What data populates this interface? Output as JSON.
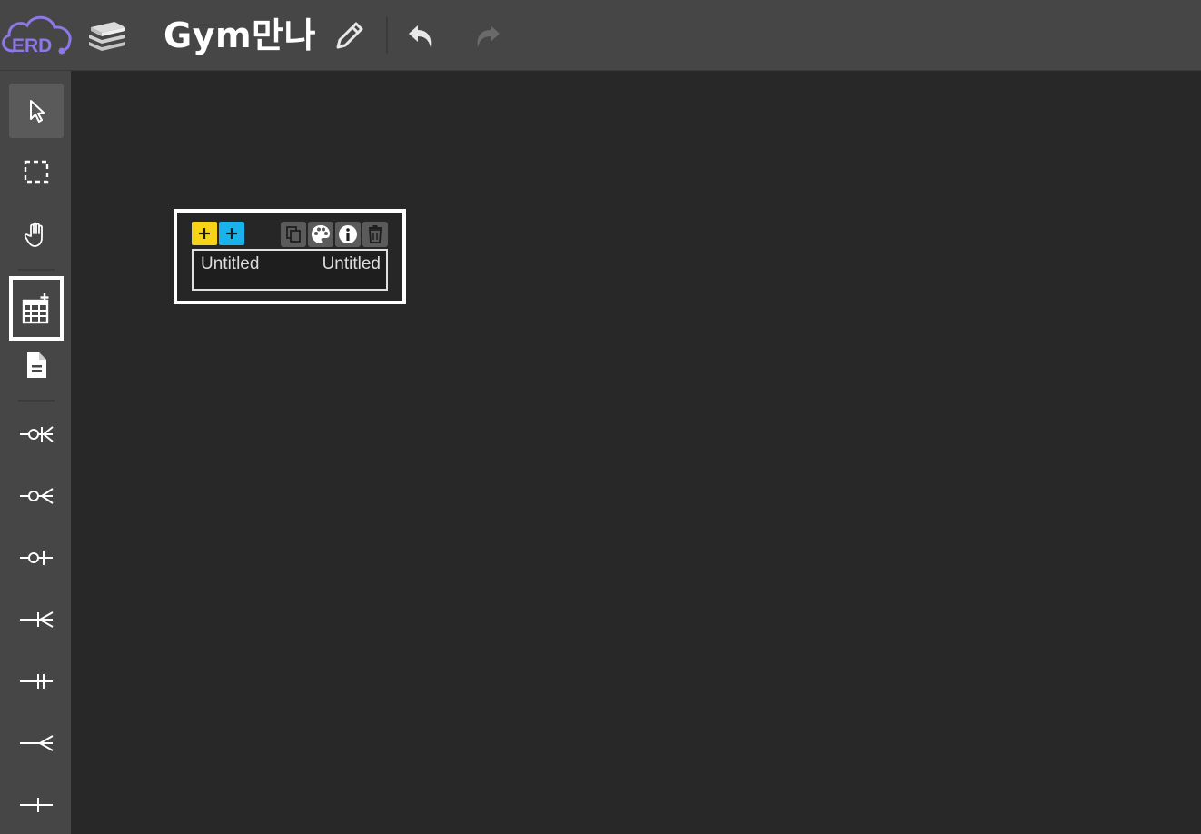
{
  "header": {
    "logo_text": "ERD",
    "title": "Gym만나",
    "logo_color": "#8e78e8"
  },
  "sidebar": {
    "tools": [
      {
        "name": "select-icon",
        "active": true
      },
      {
        "name": "drag-select-icon"
      },
      {
        "name": "hand-icon"
      },
      {
        "name": "add-table-icon",
        "highlighted": true
      },
      {
        "name": "memo-icon"
      },
      {
        "name": "relation-zero-one-many-icon"
      },
      {
        "name": "relation-zero-many-icon"
      },
      {
        "name": "relation-zero-one-icon"
      },
      {
        "name": "relation-one-many-icon"
      },
      {
        "name": "relation-one-one-icon"
      },
      {
        "name": "relation-many-icon"
      },
      {
        "name": "relation-one-icon"
      }
    ]
  },
  "table": {
    "name": "Untitled",
    "comment": "Untitled",
    "add_column_color": "#f7d417",
    "add_key_color": "#1ab2ea"
  }
}
